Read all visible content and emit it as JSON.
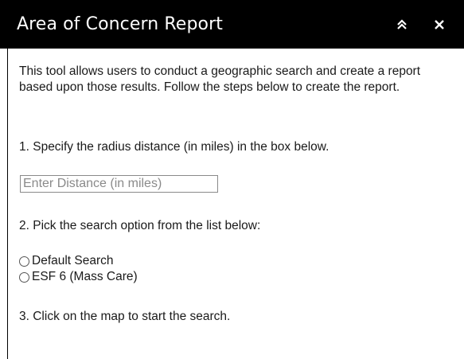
{
  "header": {
    "title": "Area of Concern Report",
    "collapse_icon": "double-chevron-up-icon",
    "close_icon": "close-icon"
  },
  "body": {
    "intro": "This tool allows users to conduct a geographic search and create a report based upon those results. Follow the steps below to create the report.",
    "step1": "1. Specify the radius distance (in miles) in the box below.",
    "distance_input": {
      "value": "",
      "placeholder": "Enter Distance (in miles)"
    },
    "step2": "2. Pick the search option from the list below:",
    "search_options": [
      {
        "label": "Default Search",
        "selected": false
      },
      {
        "label": "ESF 6 (Mass Care)",
        "selected": false
      }
    ],
    "step3": "3. Click on the map to start the search."
  },
  "colors": {
    "header_bg": "#000000",
    "header_text": "#ffffff",
    "body_text": "#1a1a1a"
  }
}
